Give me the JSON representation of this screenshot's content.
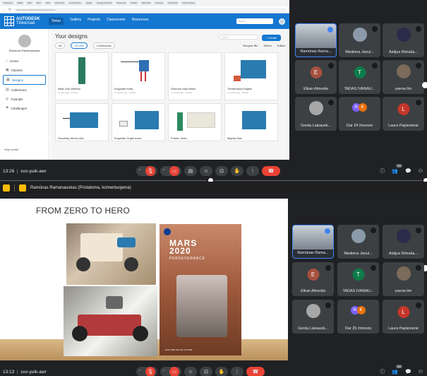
{
  "tinkercad": {
    "bookmarks": [
      "Užduotys",
      "Matai",
      "ESV",
      "ESV",
      "ESV",
      "Mokomos",
      "CoolTeacher",
      "Fadak",
      "Google Klasses",
      "Tinkercad",
      "GotRa",
      "Microsoft",
      "Lietuvos",
      "Instructab",
      "Visos adresų"
    ],
    "url": "tinkercad.com/dashboard/designs/circuits",
    "brand_line1": "AUTODESK",
    "brand_line2": "Tinkercad",
    "nav": [
      "Tinker",
      "Gallery",
      "Projects",
      "Classrooms",
      "Resources"
    ],
    "search_placeholder": "Search",
    "username": "Ramūnas Ramanauskas",
    "sidebar": [
      "Home",
      "Classes",
      "Designs",
      "Collections",
      "Tutorials",
      "Challenges"
    ],
    "help": "Help center",
    "page_title": "Your designs",
    "create": "+ Create",
    "filters": [
      "All",
      "Circuits",
      "Codeblocks"
    ],
    "filter_right": [
      "Recycle Bin",
      "Select",
      "Edited"
    ],
    "cards": [
      {
        "title": "Neat Jofo-Wambo",
        "sub": "10 days ago · Private"
      },
      {
        "title": "Exquisite Kuffy",
        "sub": "4 months ago · Private"
      },
      {
        "title": "Glorious Kasi-Wiser",
        "sub": "4 months ago · Private"
      },
      {
        "title": "Tremendous Migelo",
        "sub": "4 months ago · Private"
      },
      {
        "title": "Shocking Nimoo Allo",
        "sub": ""
      },
      {
        "title": "Exquisite Gugle Amur",
        "sub": ""
      },
      {
        "title": "Frantic Jarko",
        "sub": ""
      },
      {
        "title": "Mighty Kasi",
        "sub": ""
      }
    ]
  },
  "top": {
    "time": "13:26",
    "meeting_code": "sxo-yuik-awr",
    "people_count": "33",
    "participants": [
      {
        "name": "Ramūnas Rama...",
        "initial": "",
        "kind": "self"
      },
      {
        "name": "Medeina Janul...",
        "initial": "",
        "kind": "photo"
      },
      {
        "name": "Astijus Rimaša...",
        "initial": "",
        "kind": "photo-dark"
      },
      {
        "name": "Elkan Almeida",
        "initial": "E",
        "color": "#a5503e"
      },
      {
        "name": "TADAS IVANAU...",
        "initial": "T",
        "color": "#0d7c4a"
      },
      {
        "name": "yaena lim",
        "initial": "",
        "kind": "photo-cat"
      },
      {
        "name": "Gerda Liakausk...",
        "initial": "",
        "kind": "photo-gray"
      },
      {
        "name": "Dar 24 žmonės",
        "initial": "",
        "kind": "stack",
        "a": "N",
        "b": "K"
      },
      {
        "name": "Laura Papievienė",
        "initial": "L",
        "color": "#c5372a"
      }
    ]
  },
  "presenting": "Ramūnas Ramanauskas (Pristatoma, komentuojama)",
  "slide": {
    "title": "FROM ZERO TO HERO",
    "poster_line1": "MARS",
    "poster_line2": "2020",
    "poster_sub": "PERSEVERANCE",
    "poster_foot": "EXPLORE SOLAR SYSTEM"
  },
  "bottom": {
    "time": "13:13",
    "meeting_code": "sxo-yuik-awr",
    "people_count": "34",
    "participants": [
      {
        "name": "Ramūnas Rama...",
        "initial": "",
        "kind": "self"
      },
      {
        "name": "Medeina Janul...",
        "initial": "",
        "kind": "photo"
      },
      {
        "name": "Astijus Rimaša...",
        "initial": "",
        "kind": "photo-dark"
      },
      {
        "name": "Elkan Almeida",
        "initial": "E",
        "color": "#a5503e"
      },
      {
        "name": "TADAS IVANAU...",
        "initial": "T",
        "color": "#0d7c4a"
      },
      {
        "name": "yaena lim",
        "initial": "",
        "kind": "photo-cat"
      },
      {
        "name": "Gerda Liakausk...",
        "initial": "",
        "kind": "photo-gray"
      },
      {
        "name": "Dar 25 žmonės",
        "initial": "",
        "kind": "stack",
        "a": "N",
        "b": "K"
      },
      {
        "name": "Laura Papievienė",
        "initial": "L",
        "color": "#c5372a"
      }
    ]
  }
}
